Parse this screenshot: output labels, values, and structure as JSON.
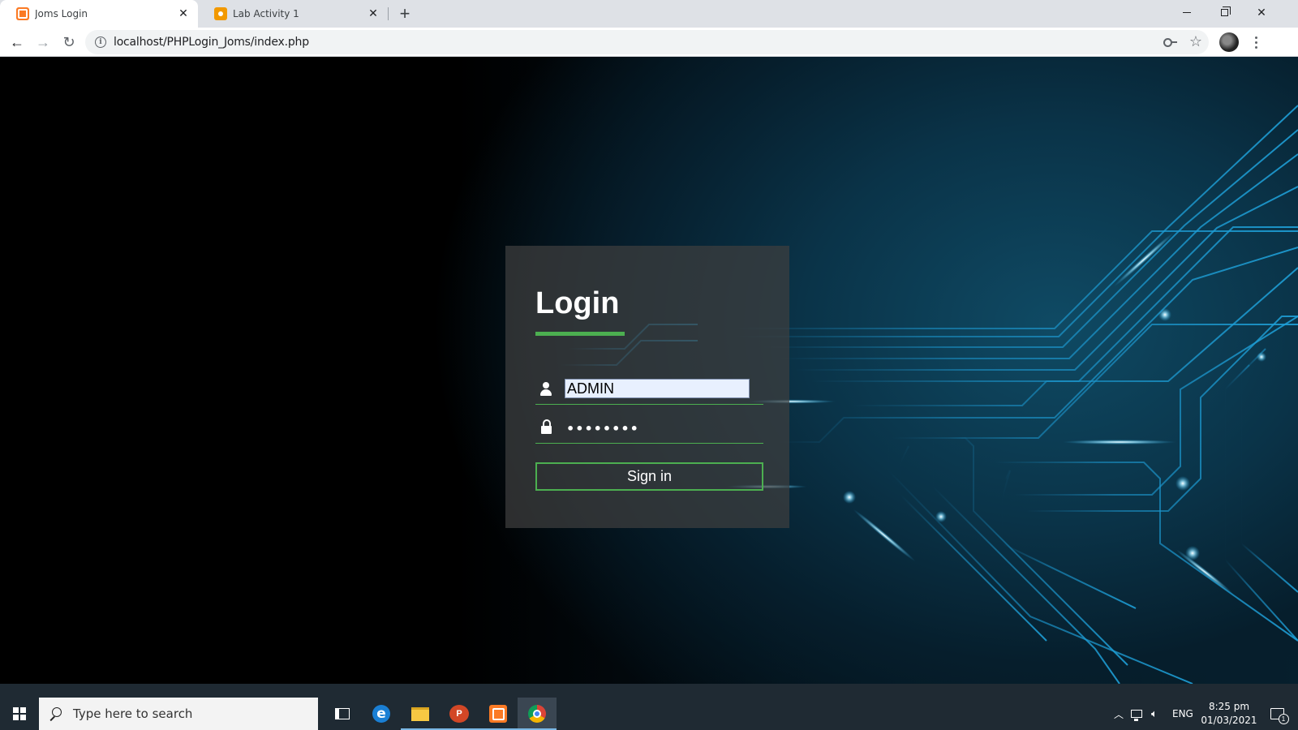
{
  "browser": {
    "tabs": [
      {
        "title": "Joms Login",
        "favicon": "xampp-icon",
        "active": true
      },
      {
        "title": "Lab Activity 1",
        "favicon": "classroom-icon",
        "active": false
      }
    ],
    "new_tab_label": "+",
    "url": "localhost/PHPLogin_Joms/index.php"
  },
  "login": {
    "title": "Login",
    "username_value": "ADMIN",
    "password_value": "••••••••",
    "signin_label": "Sign in",
    "accent_color": "#4caf50"
  },
  "taskbar": {
    "search_placeholder": "Type here to search",
    "apps": [
      "task-view",
      "edge",
      "file-explorer",
      "powerpoint",
      "xampp",
      "chrome"
    ],
    "powerpoint_glyph": "P",
    "edge_glyph": "e",
    "tray": {
      "language": "ENG",
      "time": "8:25 pm",
      "date": "01/03/2021",
      "notification_count": "1"
    }
  }
}
